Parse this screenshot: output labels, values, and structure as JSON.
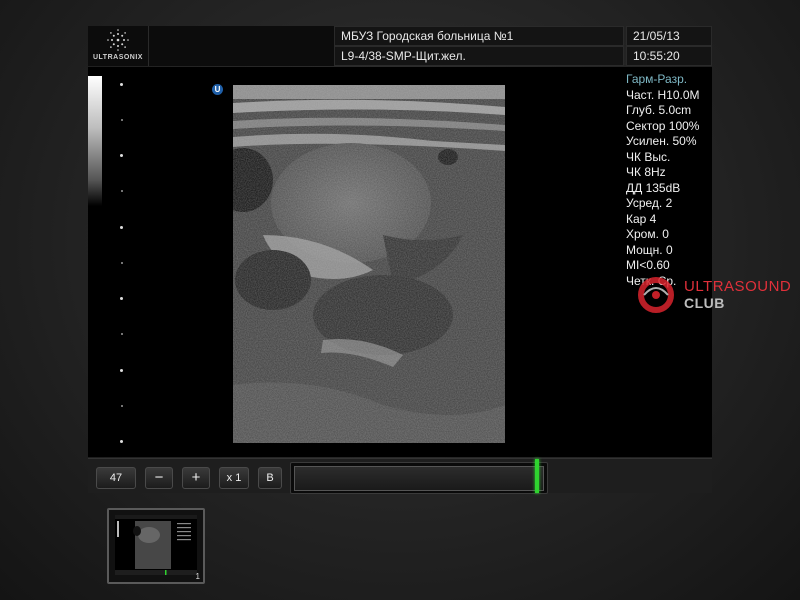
{
  "header": {
    "brand": "ULTRASONIX",
    "institution": "МБУЗ Городская больница №1",
    "preset": "L9-4/38-SMP-Щит.жел.",
    "date": "21/05/13",
    "time": "10:55:20"
  },
  "orientation_marker": "U",
  "params": {
    "mode": "Гарм-Разр.",
    "items": [
      "Част. H10.0M",
      "Глуб. 5.0cm",
      "Сектор 100%",
      "Усилен. 50%",
      "ЧК Выс.",
      "ЧК  8Hz",
      "ДД 135dB",
      "Усред. 2",
      "Кар 4",
      "Хром. 0",
      "Мощн. 0",
      "MI<0.60",
      "Четк. Ср."
    ]
  },
  "watermark": {
    "line1": "ULTRASOUND",
    "line2": "CLUB"
  },
  "toolbar": {
    "frame_value": "47",
    "minus_label": "−",
    "plus_label": "+",
    "zoom_label": "x 1",
    "mode_label": "B"
  },
  "cine": {
    "position_fraction": 0.98
  },
  "thumbnail": {
    "index": "1"
  },
  "colors": {
    "background": "#262626",
    "param_title": "#7fb9c6",
    "cine_handle": "#2fd32f",
    "watermark_red": "#e0303a",
    "orient_blue": "#1f5fa8"
  }
}
